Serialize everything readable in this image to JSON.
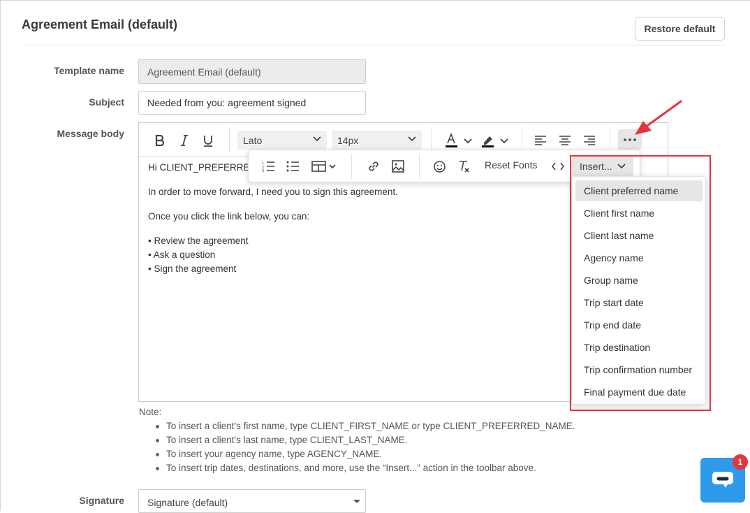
{
  "header": {
    "title": "Agreement Email (default)",
    "restore_label": "Restore default"
  },
  "form": {
    "template_name_label": "Template name",
    "template_name_value": "Agreement Email (default)",
    "subject_label": "Subject",
    "subject_value": "Needed from you: agreement signed",
    "message_body_label": "Message body",
    "signature_label": "Signature",
    "signature_value": "Signature (default)"
  },
  "toolbar": {
    "font_family": "Lato",
    "font_size": "14px",
    "reset_fonts_label": "Reset Fonts",
    "insert_label": "Insert..."
  },
  "body": {
    "greeting": "Hi CLIENT_PREFERRED",
    "line1": "In order to move forward, I need you to sign this agreement.",
    "line2": "Once you click the link below, you can:",
    "bullets": [
      "• Review the agreement",
      "• Ask a question",
      "• Sign the agreement"
    ]
  },
  "insert_menu": {
    "items": [
      "Client preferred name",
      "Client first name",
      "Client last name",
      "Agency name",
      "Group name",
      "Trip start date",
      "Trip end date",
      "Trip destination",
      "Trip confirmation number",
      "Final payment due date"
    ],
    "active_index": 0
  },
  "note": {
    "title": "Note:",
    "items": [
      "To insert a client's first name, type CLIENT_FIRST_NAME or type CLIENT_PREFERRED_NAME.",
      "To insert a client's last name, type CLIENT_LAST_NAME.",
      "To insert your agency name, type AGENCY_NAME.",
      "To insert trip dates, destinations, and more, use the “Insert...” action in the toolbar above."
    ]
  },
  "chat": {
    "badge_count": "1"
  },
  "colors": {
    "highlight_red": "#e5343d",
    "chat_blue": "#2d9be9"
  }
}
